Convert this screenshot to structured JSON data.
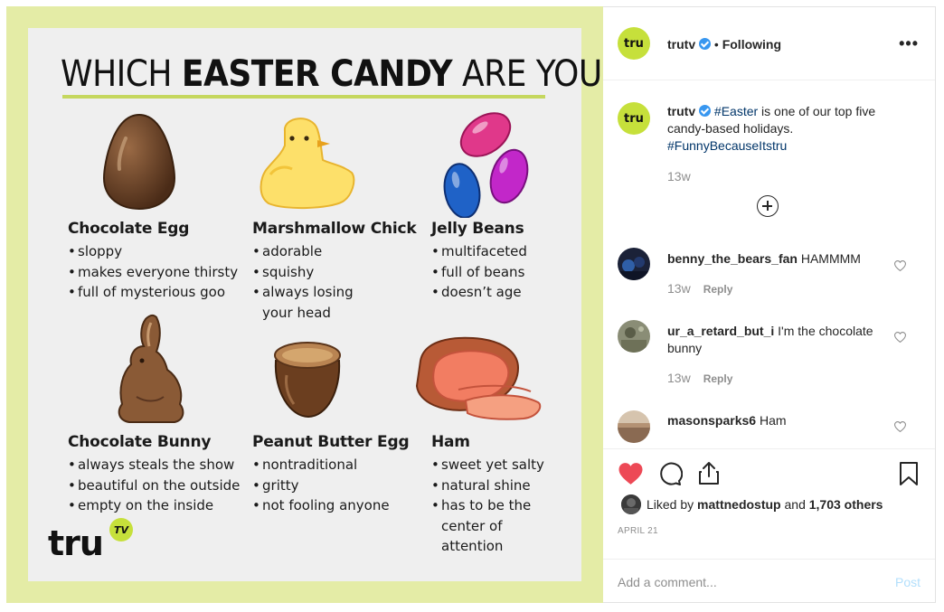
{
  "image": {
    "headline_light_1": "WHICH",
    "headline_bold": "EASTER CANDY",
    "headline_light_2": "ARE YOU?",
    "candies": [
      {
        "name": "Chocolate Egg",
        "traits": [
          "sloppy",
          "makes everyone thirsty",
          "full of mysterious goo"
        ]
      },
      {
        "name": "Marshmallow Chick",
        "traits": [
          "adorable",
          "squishy",
          "always losing",
          "your head"
        ]
      },
      {
        "name": "Jelly Beans",
        "traits": [
          "multifaceted",
          "full of beans",
          "doesn’t age"
        ]
      },
      {
        "name": "Chocolate Bunny",
        "traits": [
          "always steals the show",
          "beautiful on the outside",
          "empty on the inside"
        ]
      },
      {
        "name": "Peanut Butter Egg",
        "traits": [
          "nontraditional",
          "gritty",
          "not fooling anyone"
        ]
      },
      {
        "name": "Ham",
        "traits": [
          "sweet yet salty",
          "natural shine",
          "has to be the",
          "center of",
          "attention"
        ]
      }
    ],
    "logo_text": "tru",
    "logo_badge": "TV"
  },
  "header": {
    "username": "trutv",
    "separator": "•",
    "follow_state": "Following",
    "avatar_text": "tru",
    "more_icon": "more-horizontal-icon"
  },
  "caption": {
    "username": "trutv",
    "hashtag_1": "#Easter",
    "text": " is one of our top five candy-based holidays.",
    "hashtag_2": "#FunnyBecauseItstru",
    "timestamp": "13w"
  },
  "comments": [
    {
      "username": "benny_the_bears_fan",
      "text": "HAMMMM",
      "time": "13w",
      "reply": "Reply"
    },
    {
      "username": "ur_a_retard_but_i",
      "text": "I'm the chocolate bunny",
      "time": "13w",
      "reply": "Reply"
    },
    {
      "username": "masonsparks6",
      "text": "Ham"
    }
  ],
  "likes": {
    "prefix": "Liked by ",
    "user": "mattnedostup",
    "middle": " and ",
    "count": "1,703 others"
  },
  "date": "APRIL 21",
  "add_comment": {
    "placeholder": "Add a comment...",
    "post_label": "Post"
  },
  "colors": {
    "like_red": "#ed4956",
    "brand_green": "#c6e03b",
    "hashtag": "#003569",
    "panel_bg": "#e4eca6"
  }
}
